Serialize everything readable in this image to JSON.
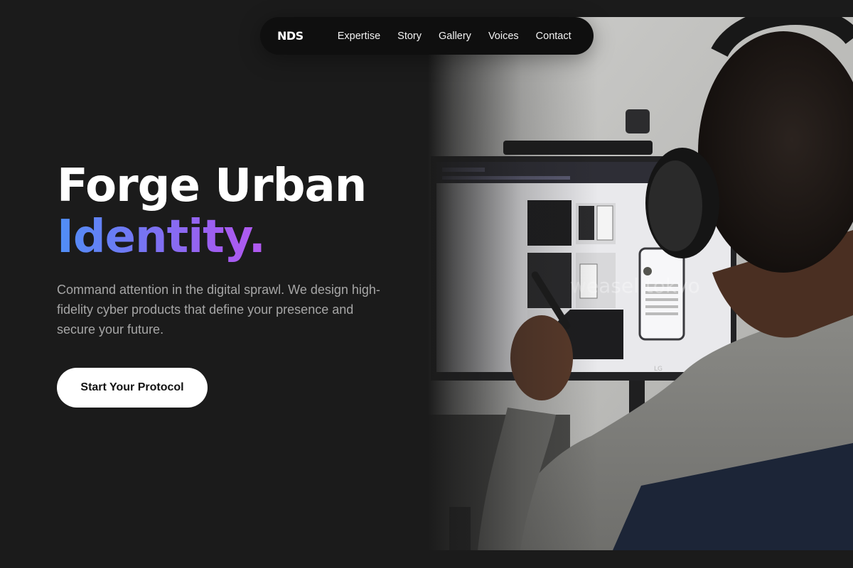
{
  "nav": {
    "logo": "NDS",
    "links": [
      {
        "label": "Expertise"
      },
      {
        "label": "Story"
      },
      {
        "label": "Gallery"
      },
      {
        "label": "Voices"
      },
      {
        "label": "Contact"
      }
    ]
  },
  "hero": {
    "title_line1": "Forge Urban",
    "title_line2": "Identity.",
    "subtitle": "Command attention in the digital sprawl. We design high-fidelity cyber products that define your presence and secure your future.",
    "cta_label": "Start Your Protocol",
    "photo_watermark": "weasel tokyo",
    "monitor_brand": "LG"
  },
  "colors": {
    "background": "#1b1b1b",
    "nav_bg": "#0f0f0f",
    "gradient_start": "#4f8ff7",
    "gradient_end": "#b25af0",
    "cta_bg": "#ffffff"
  }
}
